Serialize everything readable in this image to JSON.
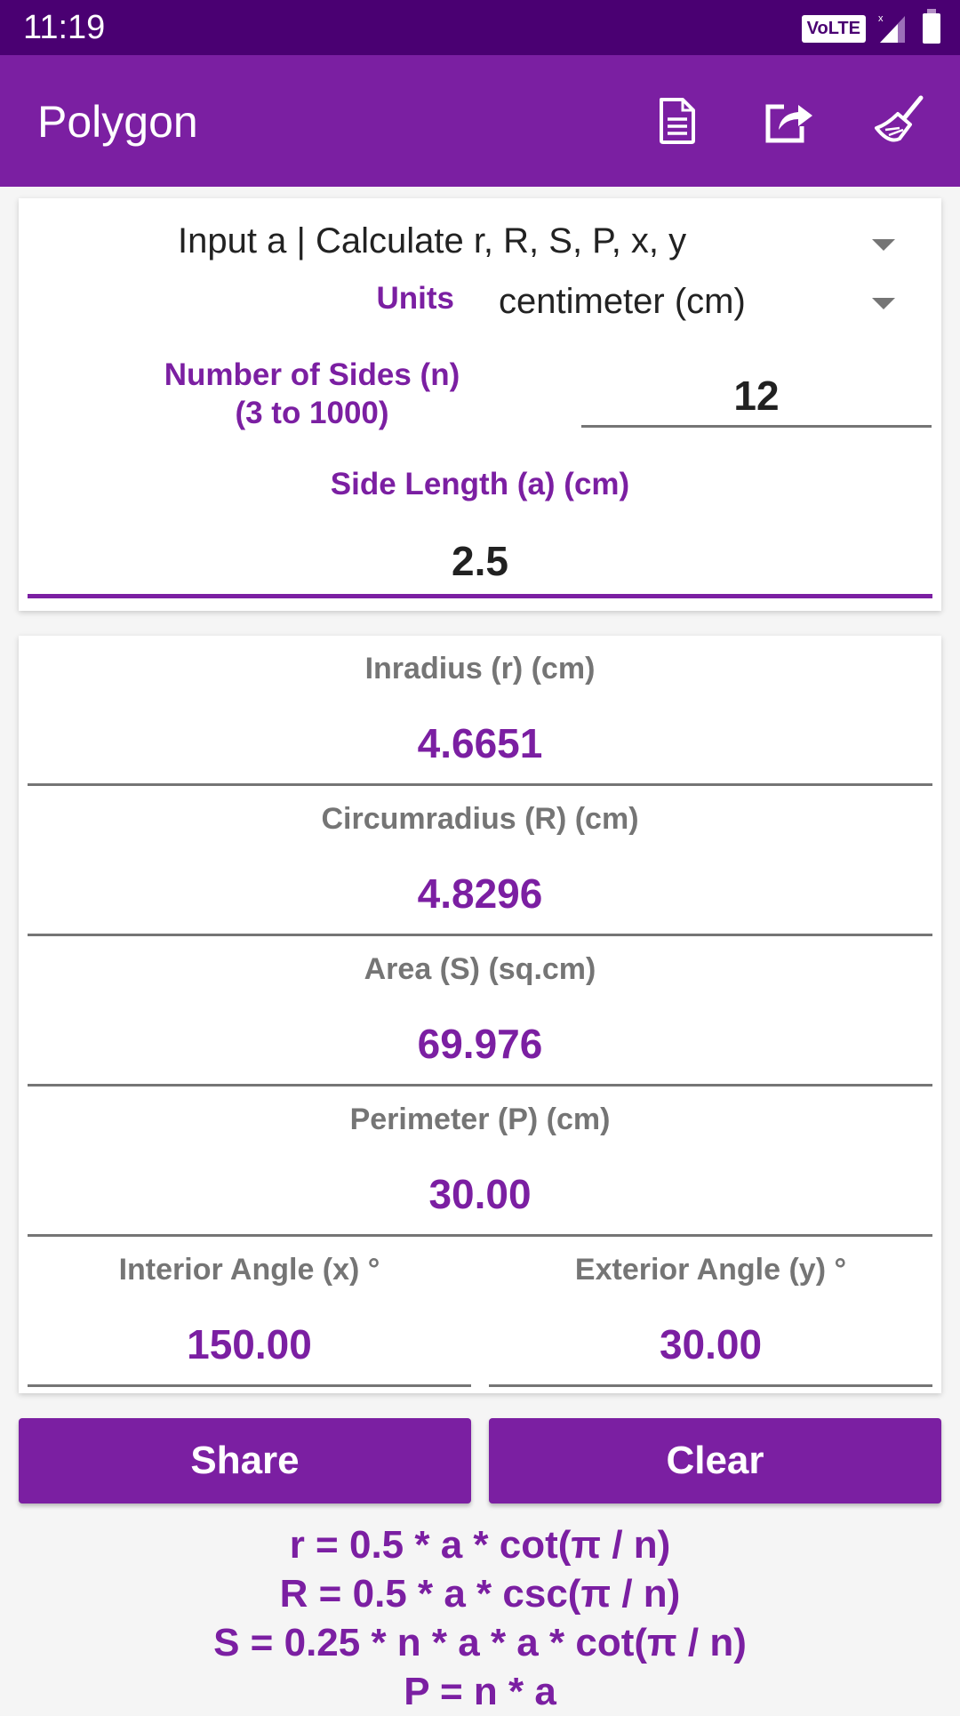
{
  "status_bar": {
    "time": "11:19",
    "volte_label": "VoLTE",
    "signal_icon": "cellular-signal-icon",
    "battery_icon": "battery-icon"
  },
  "app_bar": {
    "title": "Polygon",
    "actions": [
      {
        "name": "document-icon",
        "label": "Formulas"
      },
      {
        "name": "share-icon",
        "label": "Share"
      },
      {
        "name": "broom-icon",
        "label": "Clear"
      }
    ]
  },
  "input_card": {
    "mode_dropdown": {
      "selected": "Input a | Calculate r, R, S, P, x, y"
    },
    "units": {
      "label": "Units",
      "selected": "centimeter (cm)"
    },
    "sides": {
      "label_line1": "Number of Sides (n)",
      "label_line2": "(3 to 1000)",
      "value": "12"
    },
    "side_length": {
      "label": "Side Length (a) (cm)",
      "value": "2.5"
    }
  },
  "results": {
    "inradius": {
      "label": "Inradius (r) (cm)",
      "value": "4.6651"
    },
    "circumradius": {
      "label": "Circumradius (R) (cm)",
      "value": "4.8296"
    },
    "area": {
      "label": "Area (S) (sq.cm)",
      "value": "69.976"
    },
    "perimeter": {
      "label": "Perimeter (P) (cm)",
      "value": "30.00"
    },
    "interior_angle": {
      "label": "Interior Angle (x) °",
      "value": "150.00"
    },
    "exterior_angle": {
      "label": "Exterior Angle (y) °",
      "value": "30.00"
    }
  },
  "buttons": {
    "share": "Share",
    "clear": "Clear"
  },
  "formulas": [
    "r = 0.5 * a * cot(π / n)",
    "R = 0.5 * a * csc(π / n)",
    "S = 0.25 * n * a * a * cot(π / n)",
    "P = n * a"
  ],
  "colors": {
    "primary": "#7b1fa2",
    "primary_dark": "#4a0072",
    "label_gray": "#757575"
  }
}
